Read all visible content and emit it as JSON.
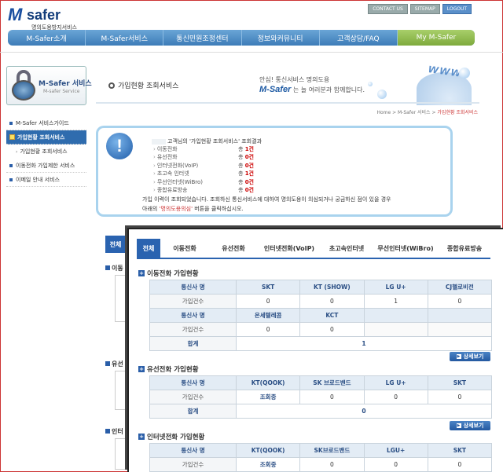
{
  "header": {
    "logo_mark": "M",
    "logo_text": "safer",
    "logo_sub": "명의도용방지서비스",
    "top_links": [
      "CONTACT US",
      "SITEMAP",
      "LOGOUT"
    ],
    "nav": [
      "M-Safer소개",
      "M-Safer서비스",
      "통신민원조정센터",
      "정보와커뮤니티",
      "고객상담/FAQ",
      "My M-Safer"
    ]
  },
  "sidebar": {
    "box_title": "M-Safer 서비스",
    "box_sub": "M-safer Service",
    "items": [
      {
        "label": "M-Safer 서비스가이드"
      },
      {
        "label": "가입현황 조회서비스"
      },
      {
        "label": "가입현황 조회서비스"
      },
      {
        "label": "이동전화 가입제한 서비스"
      },
      {
        "label": "이메일 안내 서비스"
      }
    ]
  },
  "banner": {
    "page_title": "가입현황 조회서비스",
    "line1": "안심! 통신서비스 명의도용",
    "brand": "M-Safer",
    "line2": " 는 늘 여러분과 함께합니다.",
    "www": "www",
    "breadcrumb": "Home > M-Safer 서비스 > ",
    "breadcrumb_current": "가입현황 조회서비스"
  },
  "summary": {
    "header": "고객님의 '가입현황 조회서비스' 조회결과",
    "rows": [
      {
        "label": "이동전화",
        "prefix": "총",
        "value": "1건"
      },
      {
        "label": "유선전화",
        "prefix": "총",
        "value": "0건"
      },
      {
        "label": "인터넷전화(VoIP)",
        "prefix": "총",
        "value": "0건"
      },
      {
        "label": "초고속 인터넷",
        "prefix": "총",
        "value": "1건"
      },
      {
        "label": "무선인터넷(WiBro)",
        "prefix": "총",
        "value": "0건"
      },
      {
        "label": "종합유료방송",
        "prefix": "총",
        "value": "0건"
      }
    ],
    "note1": "가입 이력이 조회되었습니다.  조회하신 통신서비스에 대하여 명의도용이 의심되거나 궁금하신 점이 있을 경우",
    "note2_pre": "아래의 ",
    "note2_link": "'명의도용의심'",
    "note2_post": " 버튼을 클릭하십시오."
  },
  "background": {
    "tab_label": "전체",
    "sections": [
      "이동",
      "유선",
      "인터"
    ]
  },
  "panel": {
    "tabs": [
      "전체",
      "이동전화",
      "유선전화",
      "인터넷전화(VoIP)",
      "초고속인터넷",
      "무선인터넷(WiBro)",
      "종합유료방송"
    ],
    "mobile": {
      "title": "이동전화 가입현황",
      "row1_headers": [
        "통신사 명",
        "SKT",
        "KT (SHOW)",
        "LG U+",
        "CJ헬로비전"
      ],
      "row1_values": [
        "가입건수",
        "0",
        "0",
        "1",
        "0"
      ],
      "row2_headers": [
        "통신사 명",
        "온세텔레콤",
        "KCT",
        "",
        ""
      ],
      "row2_values": [
        "가입건수",
        "0",
        "0",
        "",
        ""
      ],
      "total_label": "합계",
      "total_value": "1"
    },
    "wired": {
      "title": "유선전화 가입현황",
      "headers": [
        "통신사 명",
        "KT(QOOK)",
        "SK 브로드밴드",
        "LG U+",
        "SKT"
      ],
      "values": [
        "가입건수",
        "조회중",
        "0",
        "0",
        "0"
      ],
      "total_label": "합계",
      "total_value": "0"
    },
    "voip": {
      "title": "인터넷전화 가입현황",
      "headers": [
        "통신사 명",
        "KT(QOOK)",
        "SK브로드밴드",
        "LGU+",
        "SKT"
      ],
      "values": [
        "가입건수",
        "조회중",
        "0",
        "0",
        "0"
      ]
    },
    "detail_button": "상세보기"
  }
}
